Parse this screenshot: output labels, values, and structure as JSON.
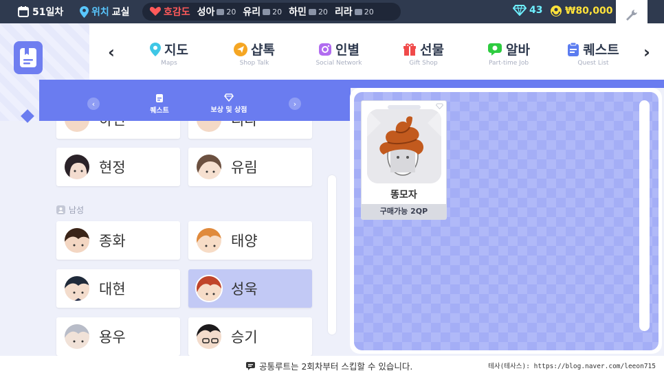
{
  "topbar": {
    "day": "51일차",
    "location_label": "위치",
    "location_value": "교실",
    "affinity_title": "호감도",
    "affinity": [
      {
        "name": "성아",
        "count": "20"
      },
      {
        "name": "유리",
        "count": "20"
      },
      {
        "name": "하민",
        "count": "20"
      },
      {
        "name": "리라",
        "count": "20"
      }
    ],
    "gems": "43",
    "money": "₩80,000"
  },
  "nav": {
    "tabs": [
      {
        "label": "지도",
        "sub": "Maps",
        "icon": "map-pin-icon",
        "color": "#3ec7e6"
      },
      {
        "label": "샵톡",
        "sub": "Shop Talk",
        "icon": "send-icon",
        "color": "#f5a623"
      },
      {
        "label": "인별",
        "sub": "Social Network",
        "icon": "camera-icon",
        "color": "#b16cf0"
      },
      {
        "label": "선물",
        "sub": "Gift Shop",
        "icon": "gift-icon",
        "color": "#f04a4a"
      },
      {
        "label": "알바",
        "sub": "Part-time Job",
        "icon": "chat-icon",
        "color": "#2ecc40"
      },
      {
        "label": "퀘스트",
        "sub": "Quest List",
        "icon": "clipboard-icon",
        "color": "#5b7cf0"
      }
    ]
  },
  "subtabs": [
    {
      "label": "퀘스트",
      "icon": "clipboard-icon"
    },
    {
      "label": "보상 및 상점",
      "icon": "diamond-icon"
    }
  ],
  "characters": {
    "top_partial": [
      "하민",
      "리라"
    ],
    "female": [
      "현정",
      "유림"
    ],
    "section_male": "남성",
    "male": [
      "종화",
      "태양",
      "대현",
      "성욱",
      "용우",
      "승기"
    ],
    "selected": "성욱"
  },
  "shop": {
    "items": [
      {
        "name": "똥모자",
        "price": "구매가능 2QP"
      }
    ]
  },
  "bottom": {
    "tip": "공통루트는 2회차부터 스킵할 수 있습니다.",
    "credit": "테사(테사스): https://blog.naver.com/leeon715"
  }
}
